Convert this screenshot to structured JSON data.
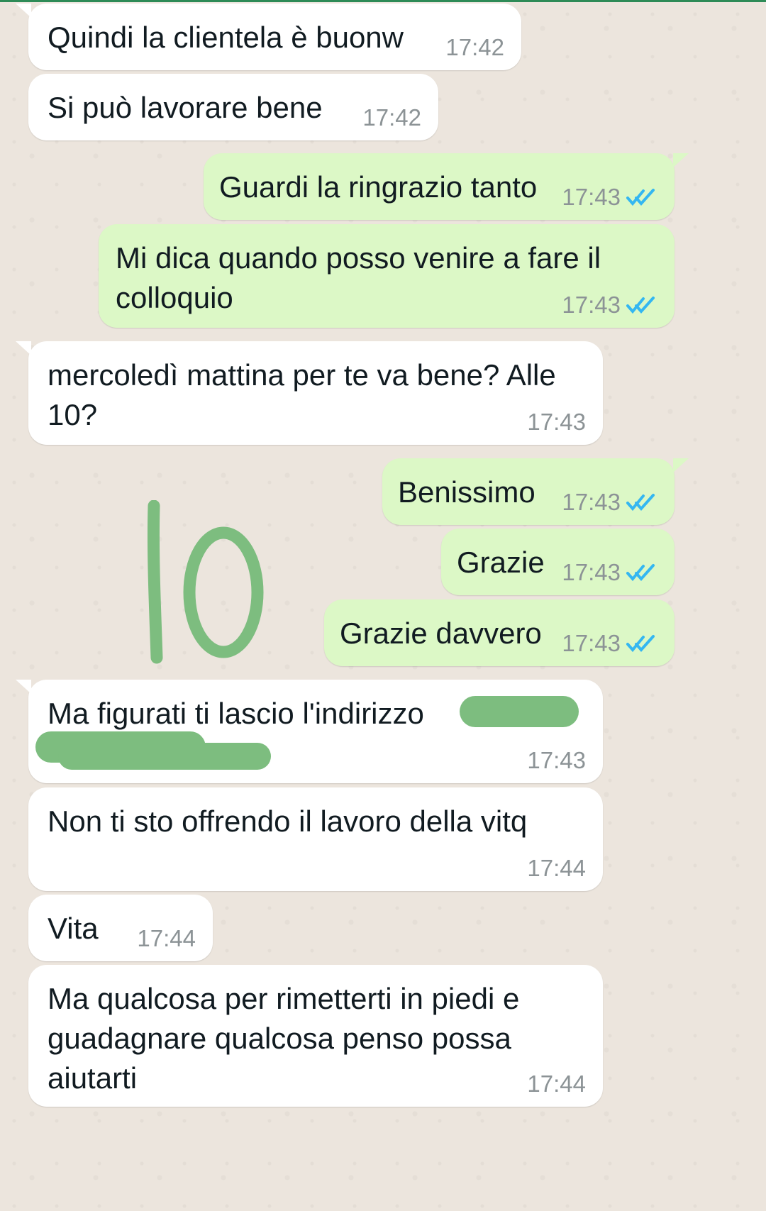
{
  "colors": {
    "incoming_bubble": "#ffffff",
    "outgoing_bubble": "#dcf8c6",
    "chat_background": "#ece5dd",
    "read_tick": "#34b7f1",
    "annotation_green": "#7dbd7f"
  },
  "messages": [
    {
      "direction": "incoming",
      "text": "Quindi la clientela è buonw",
      "time": "17:42"
    },
    {
      "direction": "incoming",
      "text": "Si può lavorare bene",
      "time": "17:42"
    },
    {
      "direction": "outgoing",
      "text": "Guardi la ringrazio tanto",
      "time": "17:43",
      "status": "read"
    },
    {
      "direction": "outgoing",
      "text": "Mi dica quando posso venire a fare il\ncolloquio",
      "time": "17:43",
      "status": "read"
    },
    {
      "direction": "incoming",
      "text": "mercoledì mattina per te va bene? Alle\n10?",
      "time": "17:43"
    },
    {
      "direction": "outgoing",
      "text": "Benissimo",
      "time": "17:43",
      "status": "read"
    },
    {
      "direction": "outgoing",
      "text": "Grazie",
      "time": "17:43",
      "status": "read"
    },
    {
      "direction": "outgoing",
      "text": "Grazie davvero",
      "time": "17:43",
      "status": "read"
    },
    {
      "direction": "incoming",
      "text": "Ma figurati ti lascio l'indirizzo",
      "time": "17:43",
      "redacted": true
    },
    {
      "direction": "incoming",
      "text": "Non ti sto offrendo il lavoro della vitq",
      "time": "17:44"
    },
    {
      "direction": "incoming",
      "text": "Vita",
      "time": "17:44"
    },
    {
      "direction": "incoming",
      "text": "Ma qualcosa per rimetterti in piedi e\nguadagnare qualcosa penso possa\naiutarti",
      "time": "17:44"
    }
  ],
  "annotation": {
    "handwritten_text": "10",
    "icon": "handwritten-ten-annotation"
  }
}
